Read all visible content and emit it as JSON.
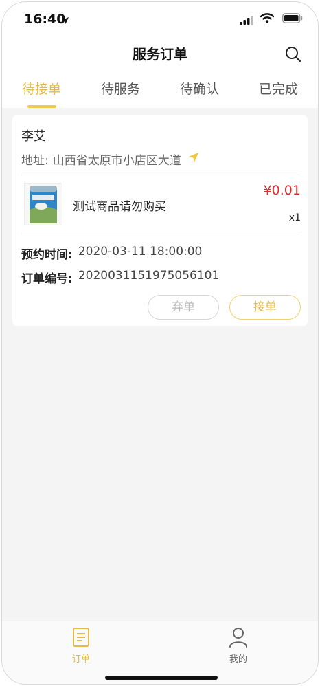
{
  "status_bar": {
    "time": "16:40"
  },
  "header": {
    "title": "服务订单"
  },
  "tabs": [
    {
      "label": "待接单",
      "active": true
    },
    {
      "label": "待服务",
      "active": false
    },
    {
      "label": "待确认",
      "active": false
    },
    {
      "label": "已完成",
      "active": false
    }
  ],
  "order": {
    "customer_name": "李艾",
    "address_label": "地址:",
    "address": "山西省太原市小店区大道",
    "product": {
      "name": "测试商品请勿购买",
      "price": "¥0.01",
      "quantity": "x1"
    },
    "appointment_label": "预约时间:",
    "appointment_time": "2020-03-11 18:00:00",
    "order_no_label": "订单编号:",
    "order_no": "2020031151975056101",
    "reject_label": "弃单",
    "accept_label": "接单"
  },
  "tabbar": {
    "orders_label": "订单",
    "mine_label": "我的"
  },
  "colors": {
    "accent": "#e6b94a",
    "price": "#d82f2f",
    "background": "#f4f4f4"
  }
}
